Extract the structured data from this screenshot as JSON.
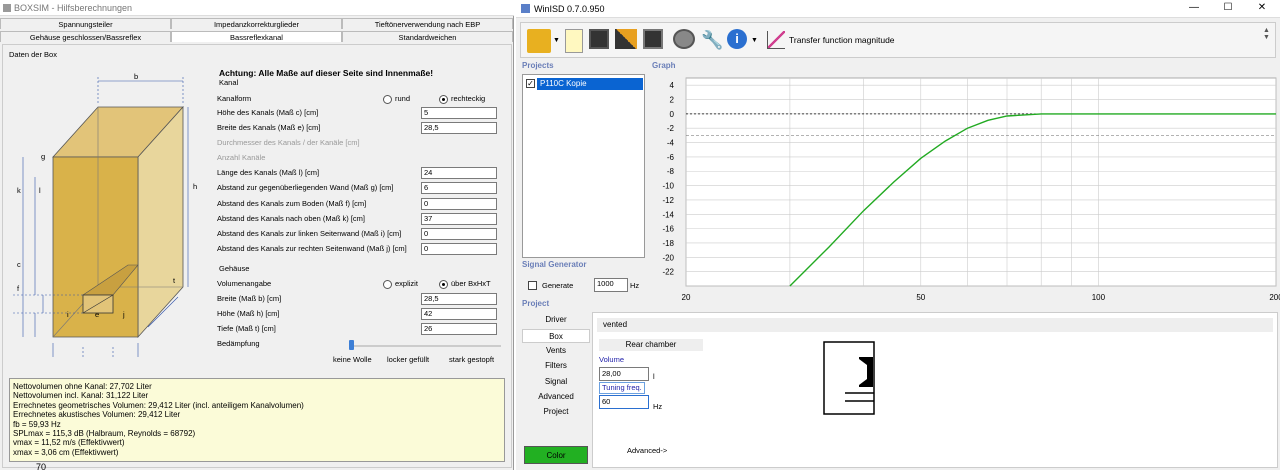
{
  "left": {
    "title": "BOXSIM - Hilfsberechnungen",
    "tabs_row1": [
      "Spannungsteiler",
      "Impedanzkorrekturglieder",
      "Tieftönerverwendung nach EBP"
    ],
    "tabs_row2": [
      "Gehäuse geschlossen/Bassreflex",
      "Bassreflexkanal",
      "Standardweichen"
    ],
    "group_label": "Daten der Box",
    "diagram_labels": {
      "b": "b",
      "g": "g",
      "k": "k",
      "l": "l",
      "h": "h",
      "c": "c",
      "f": "f",
      "t": "t",
      "i": "i",
      "e": "e",
      "j": "j"
    },
    "warning": "Achtung: Alle Maße auf dieser Seite sind Innenmaße!",
    "kanal_heading": "Kanal",
    "kanalform": {
      "label": "Kanalform",
      "opt1": "rund",
      "opt2": "rechteckig"
    },
    "fields": [
      {
        "label": "Höhe des Kanals (Maß c) [cm]",
        "value": "5"
      },
      {
        "label": "Breite des Kanals (Maß e) [cm]",
        "value": "28,5"
      },
      {
        "label": "Durchmesser des Kanals / der Kanäle [cm]",
        "value": ""
      },
      {
        "label": "Anzahl Kanäle",
        "value": ""
      },
      {
        "label": "Länge des Kanals (Maß l) [cm]",
        "value": "24"
      },
      {
        "label": "Abstand zur gegenüberliegenden Wand (Maß g) [cm]",
        "value": "6"
      },
      {
        "label": "Abstand des Kanals zum Boden (Maß f) [cm]",
        "value": "0"
      },
      {
        "label": "Abstand des Kanals nach oben (Maß k) [cm]",
        "value": "37"
      },
      {
        "label": "Abstand des Kanals zur linken Seitenwand (Maß i) [cm]",
        "value": "0"
      },
      {
        "label": "Abstand des Kanals zur rechten Seitenwand (Maß j) [cm]",
        "value": "0"
      }
    ],
    "gehaeuse_heading": "Gehäuse",
    "volumen": {
      "label": "Volumenangabe",
      "opt1": "explizit",
      "opt2": "über BxHxT"
    },
    "dims": [
      {
        "label": "Breite (Maß b) [cm]",
        "value": "28,5"
      },
      {
        "label": "Höhe (Maß h) [cm]",
        "value": "42"
      },
      {
        "label": "Tiefe (Maß t) [cm]",
        "value": "26"
      }
    ],
    "daempfung": {
      "label": "Bedämpfung",
      "a": "keine Wolle",
      "b": "locker gefüllt",
      "c": "stark gestopft",
      "level": 0
    },
    "results": [
      "Nettovolumen ohne Kanal: 27,702 Liter",
      "Nettovolumen incl. Kanal: 31,122 Liter",
      "Errechnetes geometrisches Volumen: 29,412 Liter (incl. anteiligem Kanalvolumen)",
      "Errechnetes akustisches Volumen: 29,412 Liter",
      "fb = 59,93 Hz",
      "SPLmax = 115,3 dB (Halbraum, Reynolds = 68792)",
      "vmax = 11,52 m/s (Effektivwert)",
      "xmax = 3,06 cm (Effektivwert)"
    ],
    "cut_text": "70"
  },
  "right": {
    "title": "WinISD 0.7.0.950",
    "toolbar_label": "Transfer function magnitude",
    "projects_label": "Projects",
    "graph_label": "Graph",
    "project_item": "P110C Kopie",
    "siggen_label": "Signal Generator",
    "generate_label": "Generate",
    "freq_value": "1000",
    "freq_unit": "Hz",
    "project_label": "Project",
    "nav": [
      "Driver",
      "Box",
      "Vents",
      "Filters",
      "Signal",
      "Advanced",
      "Project"
    ],
    "color_btn": "Color",
    "box_type": "vented",
    "rear_chamber": "Rear chamber",
    "volume_label": "Volume",
    "volume_value": "28,00",
    "volume_unit": "l",
    "tuning_label": "Tuning freq.",
    "tuning_value": "60",
    "tuning_unit": "Hz",
    "advanced_link": "Advanced->"
  },
  "chart_data": {
    "type": "line",
    "x_scale": "log",
    "xlim": [
      20,
      200
    ],
    "ylim": [
      -24,
      5
    ],
    "x_ticks": [
      "20",
      "50",
      "100",
      "200"
    ],
    "y_ticks": [
      "4",
      "2",
      "0",
      "-2",
      "-4",
      "-6",
      "-8",
      "-10",
      "-12",
      "-14",
      "-16",
      "-18",
      "-20",
      "-22"
    ],
    "ref_lines": [
      0,
      -3
    ],
    "series": [
      {
        "color": "#22aa22",
        "x": [
          30,
          35,
          40,
          45,
          50,
          55,
          60,
          65,
          70,
          80,
          90,
          100,
          200
        ],
        "y": [
          -24,
          -18.5,
          -13.5,
          -9.5,
          -6.2,
          -3.8,
          -2.0,
          -0.9,
          -0.3,
          0.0,
          0.0,
          0.0,
          0.0
        ]
      }
    ]
  }
}
